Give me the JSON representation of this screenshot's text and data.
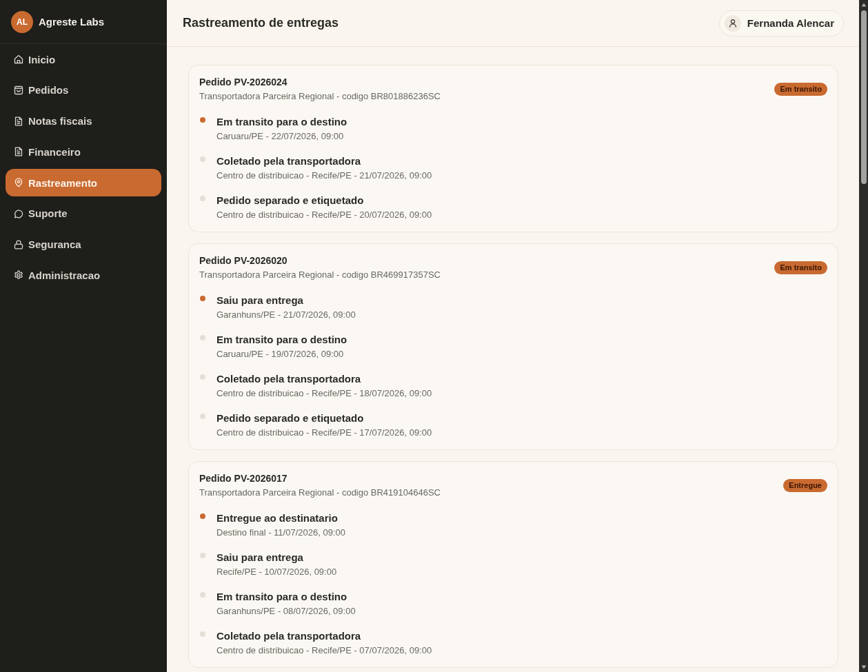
{
  "sidebar": {
    "brand": {
      "initials": "AL",
      "name": "Agreste Labs"
    },
    "items": [
      {
        "label": "Inicio",
        "selected": false
      },
      {
        "label": "Pedidos",
        "selected": false
      },
      {
        "label": "Notas fiscais",
        "selected": false
      },
      {
        "label": "Financeiro",
        "selected": false
      },
      {
        "label": "Rastreamento",
        "selected": true
      },
      {
        "label": "Suporte",
        "selected": false
      },
      {
        "label": "Seguranca",
        "selected": false
      },
      {
        "label": "Administracao",
        "selected": false
      }
    ]
  },
  "header": {
    "title": "Rastreamento de entregas",
    "user": "Fernanda Alencar"
  },
  "shipments": [
    {
      "title": "Pedido PV-2026024",
      "carrier": "Transportadora Parceira Regional - codigo BR801886236SC",
      "status": "Em transito",
      "events": [
        {
          "title": "Em transito para o destino",
          "detail": "Caruaru/PE - 22/07/2026, 09:00",
          "current": true
        },
        {
          "title": "Coletado pela transportadora",
          "detail": "Centro de distribuicao - Recife/PE - 21/07/2026, 09:00",
          "current": false
        },
        {
          "title": "Pedido separado e etiquetado",
          "detail": "Centro de distribuicao - Recife/PE - 20/07/2026, 09:00",
          "current": false
        }
      ]
    },
    {
      "title": "Pedido PV-2026020",
      "carrier": "Transportadora Parceira Regional - codigo BR469917357SC",
      "status": "Em transito",
      "events": [
        {
          "title": "Saiu para entrega",
          "detail": "Garanhuns/PE - 21/07/2026, 09:00",
          "current": true
        },
        {
          "title": "Em transito para o destino",
          "detail": "Caruaru/PE - 19/07/2026, 09:00",
          "current": false
        },
        {
          "title": "Coletado pela transportadora",
          "detail": "Centro de distribuicao - Recife/PE - 18/07/2026, 09:00",
          "current": false
        },
        {
          "title": "Pedido separado e etiquetado",
          "detail": "Centro de distribuicao - Recife/PE - 17/07/2026, 09:00",
          "current": false
        }
      ]
    },
    {
      "title": "Pedido PV-2026017",
      "carrier": "Transportadora Parceira Regional - codigo BR419104646SC",
      "status": "Entregue",
      "events": [
        {
          "title": "Entregue ao destinatario",
          "detail": "Destino final - 11/07/2026, 09:00",
          "current": true
        },
        {
          "title": "Saiu para entrega",
          "detail": "Recife/PE - 10/07/2026, 09:00",
          "current": false
        },
        {
          "title": "Em transito para o destino",
          "detail": "Garanhuns/PE - 08/07/2026, 09:00",
          "current": false
        },
        {
          "title": "Coletado pela transportadora",
          "detail": "Centro de distribuicao - Recife/PE - 07/07/2026, 09:00",
          "current": false
        }
      ]
    }
  ]
}
